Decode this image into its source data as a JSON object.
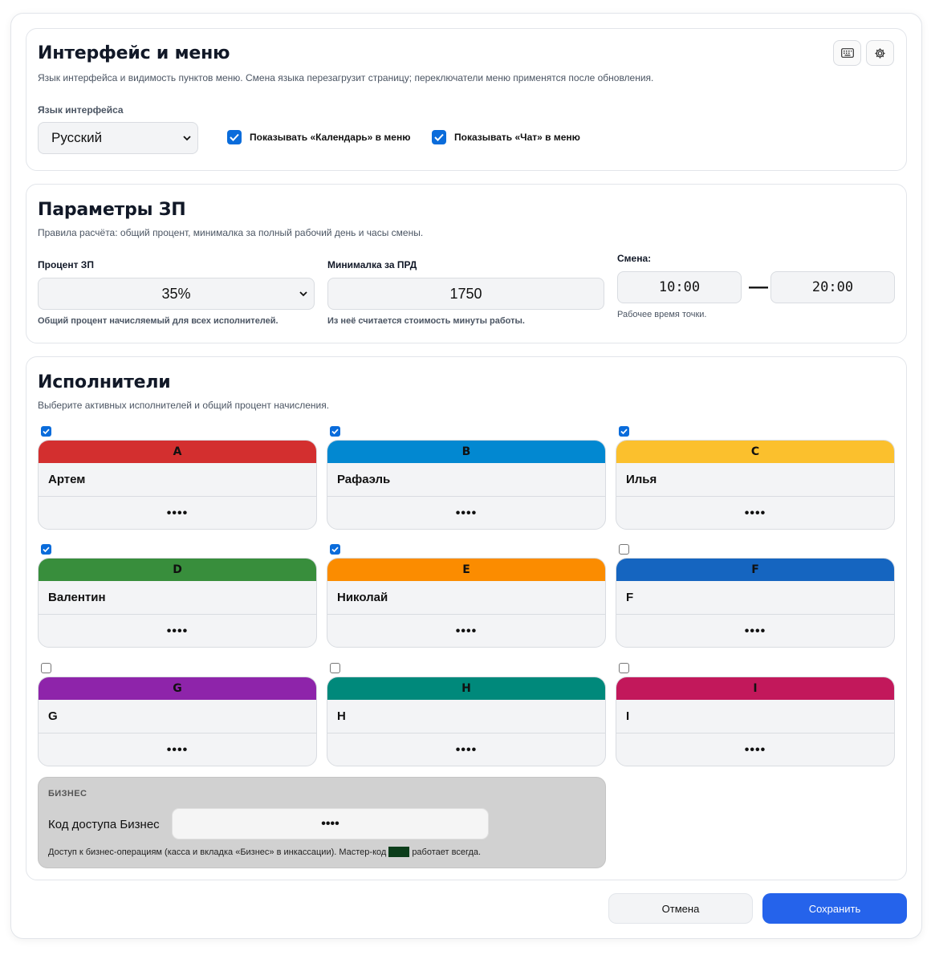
{
  "interface": {
    "title": "Интерфейс и меню",
    "description": "Язык интерфейса и видимость пунктов меню. Смена языка перезагрузит страницу; переключатели меню применятся после обновления.",
    "language_label": "Язык интерфейса",
    "language_value": "Русский",
    "show_calendar_label": "Показывать «Календарь» в меню",
    "show_calendar_checked": true,
    "show_chat_label": "Показывать «Чат» в меню",
    "show_chat_checked": true,
    "icons": [
      "keyboard-icon",
      "gear-icon"
    ]
  },
  "salary": {
    "title": "Параметры ЗП",
    "description": "Правила расчёта: общий процент, минималка за полный рабочий день и часы смены.",
    "percent_label": "Процент ЗП",
    "percent_value": "35%",
    "percent_hint": "Общий процент начисляемый для всех исполнителей.",
    "min_label": "Минималка за ПРД",
    "min_value": "1750",
    "min_hint": "Из неё считается стоимость минуты работы.",
    "shift_label": "Смена:",
    "shift_start": "10:00",
    "shift_dash": "—",
    "shift_end": "20:00",
    "shift_hint": "Рабочее время точки."
  },
  "workers": {
    "title": "Исполнители",
    "description": "Выберите активных исполнителей и общий процент начисления.",
    "items": [
      {
        "letter": "A",
        "name": "Артем",
        "pin": "••••",
        "checked": true,
        "color": "#d32f2f"
      },
      {
        "letter": "B",
        "name": "Рафаэль",
        "pin": "••••",
        "checked": true,
        "color": "#0288d1"
      },
      {
        "letter": "C",
        "name": "Илья",
        "pin": "••••",
        "checked": true,
        "color": "#fbc02d"
      },
      {
        "letter": "D",
        "name": "Валентин",
        "pin": "••••",
        "checked": true,
        "color": "#388e3c"
      },
      {
        "letter": "E",
        "name": "Николай",
        "pin": "••••",
        "checked": true,
        "color": "#fb8c00"
      },
      {
        "letter": "F",
        "name": "F",
        "pin": "••••",
        "checked": false,
        "color": "#1565c0"
      },
      {
        "letter": "G",
        "name": "G",
        "pin": "••••",
        "checked": false,
        "color": "#8e24aa"
      },
      {
        "letter": "H",
        "name": "H",
        "pin": "••••",
        "checked": false,
        "color": "#00897b"
      },
      {
        "letter": "I",
        "name": "I",
        "pin": "••••",
        "checked": false,
        "color": "#c2185b"
      }
    ]
  },
  "business": {
    "heading": "БИЗНЕС",
    "code_label": "Код доступа Бизнес",
    "code_value": "••••",
    "note_before": "Доступ к бизнес-операциям (касса и вкладка «Бизнес» в инкассации). Мастер-код",
    "note_after": "работает всегда.",
    "master_code_color": "#0b3d1a"
  },
  "actions": {
    "cancel_label": "Отмена",
    "save_label": "Сохранить",
    "save_color": "#2563eb"
  }
}
